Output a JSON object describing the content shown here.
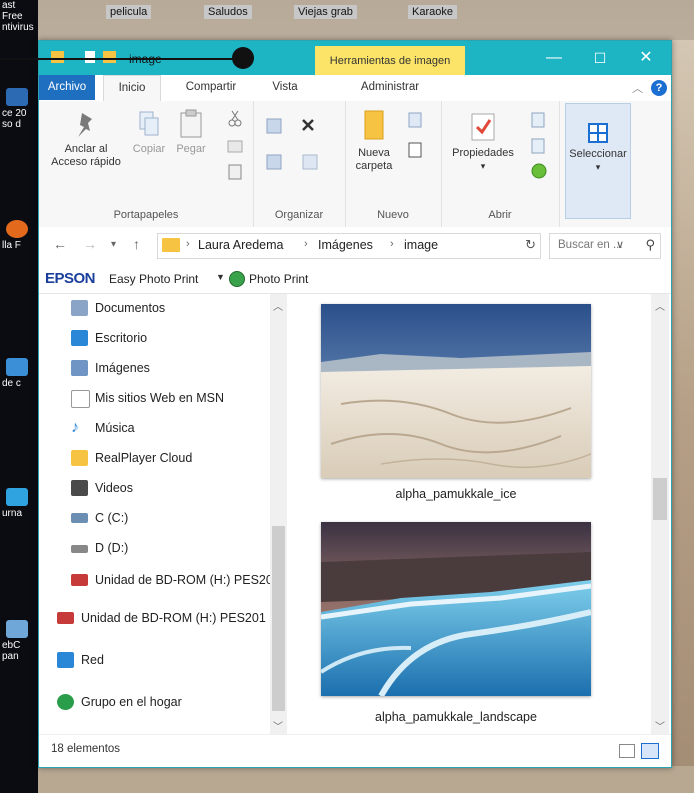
{
  "desktop": {
    "left_icons": [
      {
        "label": "ast Free\nntivirus",
        "color": "#1c1c1c"
      },
      {
        "label": "ce 20\nso d",
        "color": "#2c6bb4"
      },
      {
        "label": "lla F",
        "color": "#e36a1d"
      },
      {
        "label": "de c",
        "color": "#3b8fd6"
      },
      {
        "label": "urna",
        "color": "#2fa3df"
      },
      {
        "label": "ebC\npan",
        "color": "#6ea7d8"
      }
    ],
    "top_labels": [
      "pelicula",
      "Saludos",
      "Viejas grab",
      "Karaoke"
    ]
  },
  "window": {
    "title": "image",
    "context_tab_header": "Herramientas de imagen",
    "controls": {
      "minimize": "—",
      "maximize": "☐",
      "close": "✕"
    }
  },
  "tabs": [
    {
      "label": "Archivo",
      "active": false
    },
    {
      "label": "Inicio",
      "active": true
    },
    {
      "label": "Compartir",
      "active": false
    },
    {
      "label": "Vista",
      "active": false
    },
    {
      "label": "Administrar",
      "active": false
    }
  ],
  "ribbon": {
    "portapapeles": {
      "label": "Portapapeles",
      "anclar": "Anclar al\nAcceso rápido",
      "copiar": "Copiar",
      "pegar": "Pegar"
    },
    "organizar": {
      "label": "Organizar"
    },
    "nuevo": {
      "label": "Nuevo",
      "nueva_carpeta": "Nueva\ncarpeta"
    },
    "abrir": {
      "label": "Abrir",
      "propiedades": "Propiedades"
    },
    "seleccionar": {
      "label": "Seleccionar"
    }
  },
  "address": {
    "crumbs": [
      "Laura Aredema",
      "Imágenes",
      "image"
    ],
    "search_placeholder": "Buscar en ..."
  },
  "epson": {
    "logo": "EPSON",
    "easy_photo": "Easy Photo Print",
    "photo_print": "Photo Print"
  },
  "nav": {
    "items": [
      {
        "label": "Documentos",
        "color": "#8aa4c8"
      },
      {
        "label": "Escritorio",
        "color": "#2a86d6"
      },
      {
        "label": "Imágenes",
        "color": "#6e95c4"
      },
      {
        "label": "Mis sitios Web en MSN",
        "color": "#ffffff"
      },
      {
        "label": "Música",
        "color": "#2a86d6"
      },
      {
        "label": "RealPlayer Cloud",
        "color": "#f6c343"
      },
      {
        "label": "Videos",
        "color": "#4a4a4a"
      },
      {
        "label": "C (C:)",
        "color": "#6b8fb3"
      },
      {
        "label": "D (D:)",
        "color": "#888888"
      },
      {
        "label": "Unidad de BD-ROM (H:) PES20",
        "color": "#c73a3a"
      },
      {
        "label": "Unidad de BD-ROM (H:) PES201",
        "color": "#c73a3a"
      },
      {
        "label": "Red",
        "color": "#2a86d6"
      },
      {
        "label": "Grupo en el hogar",
        "color": "#2a9d4a"
      }
    ]
  },
  "files": [
    {
      "name": "alpha_pamukkale_ice"
    },
    {
      "name": "alpha_pamukkale_landscape"
    }
  ],
  "status": {
    "count": "18 elementos"
  }
}
